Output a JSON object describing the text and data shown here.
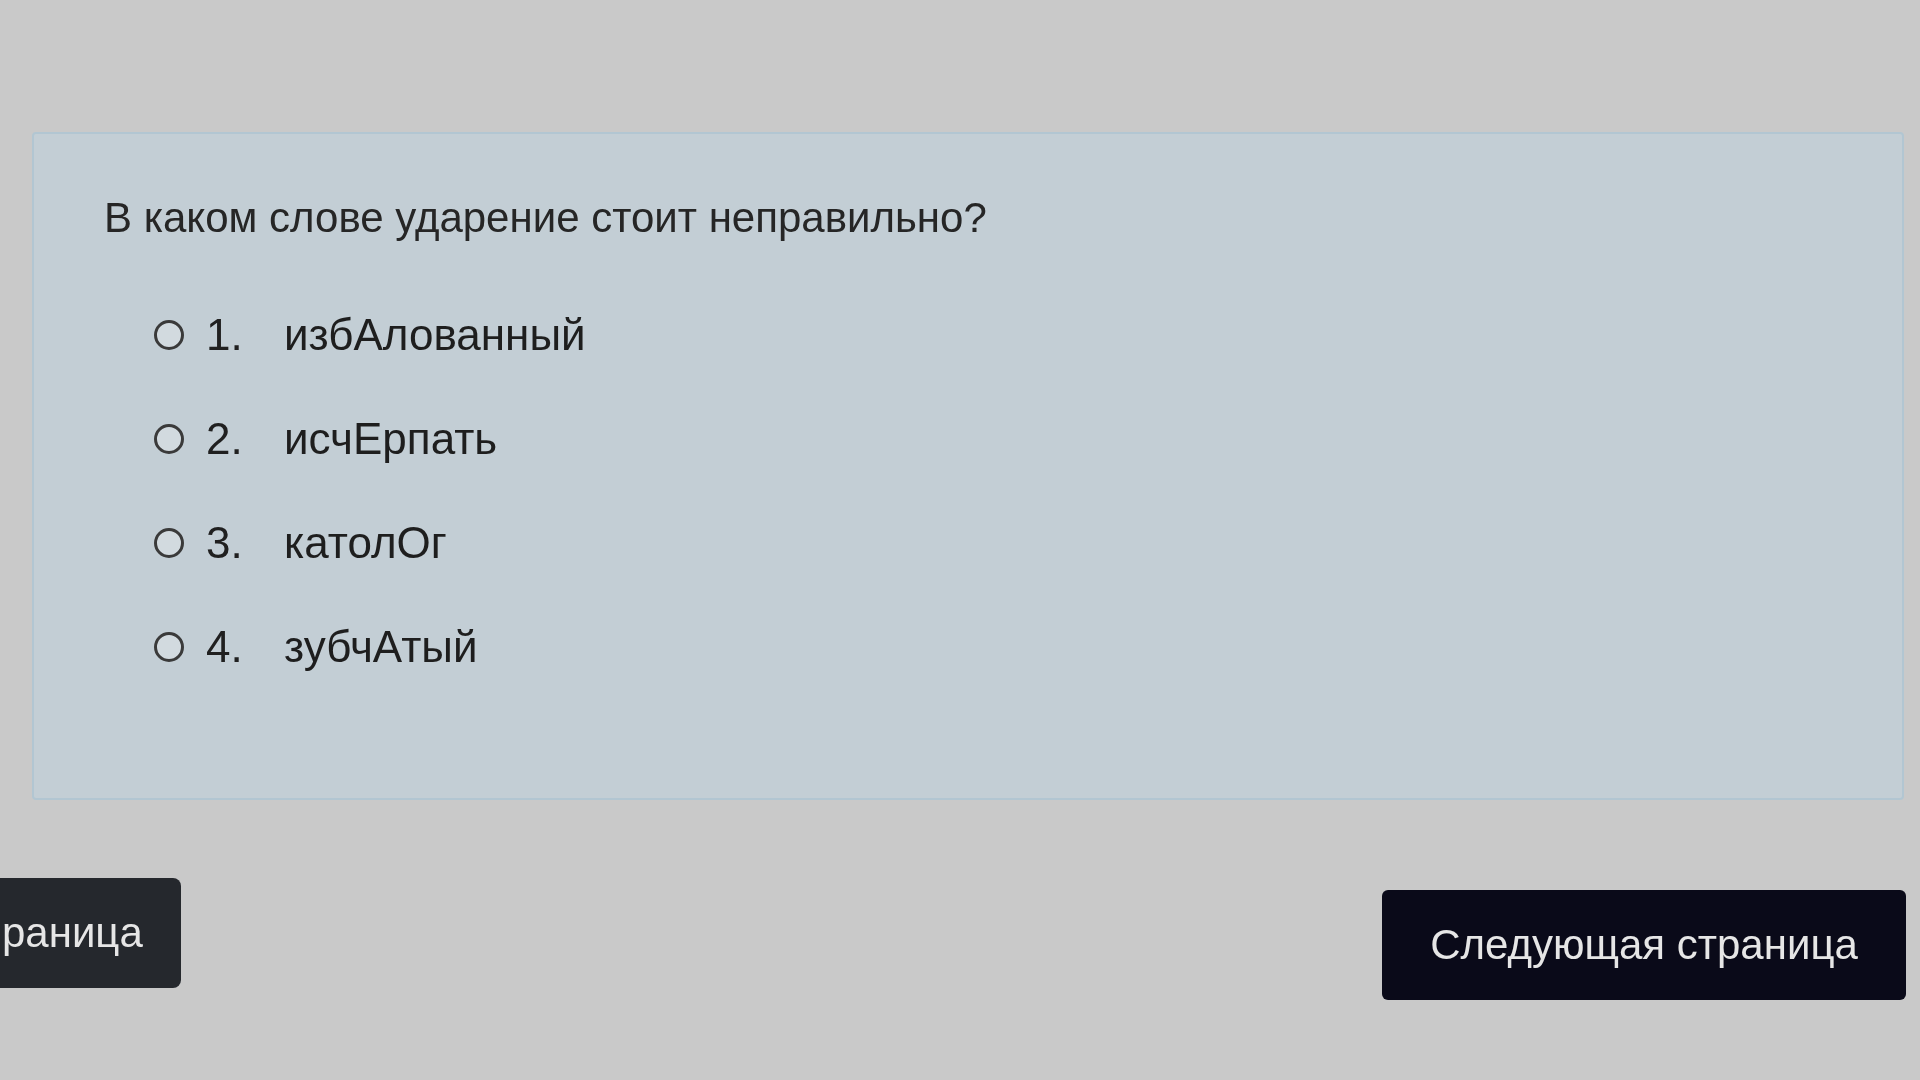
{
  "question": {
    "text": "В каком слове ударение стоит неправильно?"
  },
  "options": [
    {
      "number": "1.",
      "text": "избАлованный",
      "selected": false
    },
    {
      "number": "2.",
      "text": "исчЕрпать",
      "selected": false
    },
    {
      "number": "3.",
      "text": "католОг",
      "selected": false
    },
    {
      "number": "4.",
      "text": "зубчАтый",
      "selected": false
    }
  ],
  "navigation": {
    "previous": {
      "label": "раница"
    },
    "next": {
      "label": "Следующая страница"
    }
  }
}
